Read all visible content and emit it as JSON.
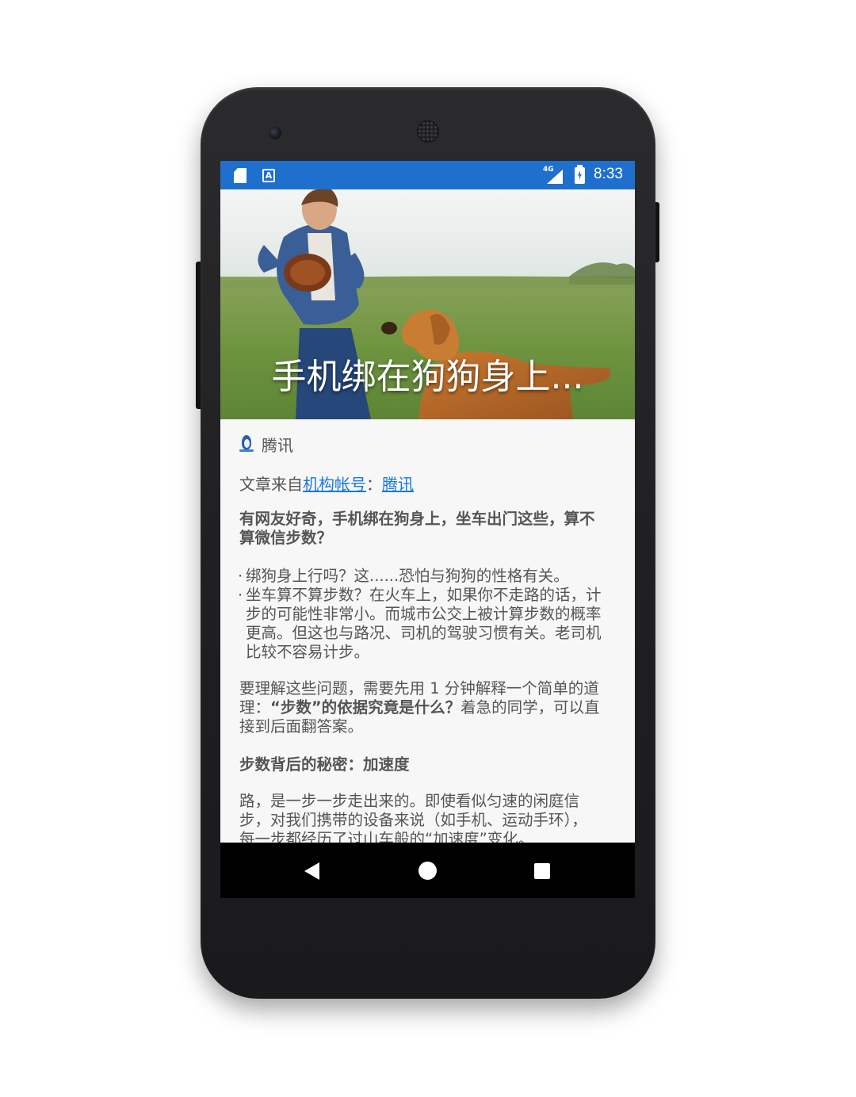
{
  "status_bar": {
    "time": "8:33",
    "network": "4G",
    "icons": [
      "sd-card-icon",
      "a-notification-icon",
      "signal-icon",
      "battery-charging-icon"
    ],
    "background_color": "#1e6fce"
  },
  "hero": {
    "title": "手机绑在狗狗身上..."
  },
  "article": {
    "source": {
      "icon": "tencent-penguin-icon",
      "name": "腾讯"
    },
    "meta": {
      "prefix": "文章来自",
      "account_link": "机构帐号",
      "separator": "：",
      "source_link": "腾讯"
    },
    "question": {
      "line1": "有网友好奇，手机绑在狗身上，坐车出门这些，算不",
      "line2": "算微信步数？"
    },
    "bullets": [
      [
        "绑狗身上行吗？这......恐怕与狗狗的性格有关。"
      ],
      [
        "坐车算不算步数？在火车上，如果你不走路的话，计",
        "步的可能性非常小。而城市公交上被计算步数的概率",
        "更高。但这也与路况、司机的驾驶习惯有关。老司机",
        "比较不容易计步。"
      ]
    ],
    "explain": {
      "line1": "要理解这些问题，需要先用 1 分钟解释一个简单的道",
      "line2_pre": "理：",
      "line2_bold": "“步数”的依据究竟是什么？",
      "line2_post": "着急的同学，可以直",
      "line3": "接到后面翻答案。"
    },
    "section_heading": "步数背后的秘密：加速度",
    "body": {
      "line1": "路，是一步一步走出来的。即使看似匀速的闲庭信",
      "line2": "步，对我们携带的设备来说（如手机、运动手环），",
      "line3": "每一步都经历了过山车般的“加速度”变化。"
    },
    "link_color": "#1a79d4"
  },
  "nav_bar": {
    "buttons": [
      "back-icon",
      "home-icon",
      "recents-icon"
    ]
  }
}
